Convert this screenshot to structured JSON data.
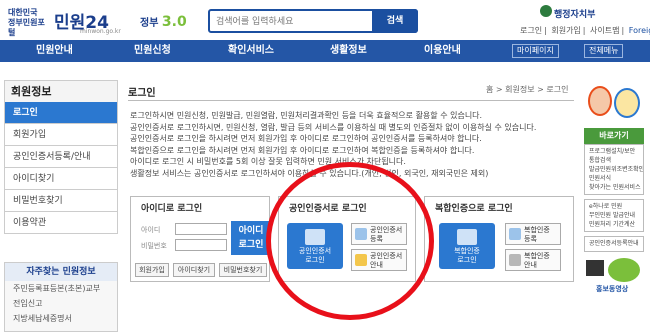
{
  "header": {
    "logo_small": "대한민국\n정부민원포털",
    "logo_main": "민원24",
    "logo_sub": "minwon.go.kr",
    "gov_label": "정부",
    "gov_version": "3.0",
    "search_placeholder": "검색어를 입력하세요",
    "search_button": "검색",
    "ministry": "행정자치부",
    "links": [
      "로그인",
      "회원가입",
      "사이트맵",
      "Foreigner"
    ]
  },
  "gnb": {
    "items": [
      "민원안내",
      "민원신청",
      "확인서비스",
      "생활정보",
      "이용안내"
    ],
    "mypage": "마이페이지",
    "allmenu": "전체메뉴"
  },
  "sidebar": {
    "title": "회원정보",
    "items": [
      "로그인",
      "회원가입",
      "공인인증서등록/안내",
      "아이디찾기",
      "비밀번호찾기",
      "이용약관"
    ],
    "faq_title": "자주찾는 민원정보",
    "faq_items": [
      "주민등록표등본(초본)교부",
      "전입신고",
      "지방세납세증명서"
    ]
  },
  "content": {
    "title": "로그인",
    "breadcrumb": "홈 > 회원정보 > 로그인",
    "notes": [
      "로그인하시면 민원신청, 민원발급, 민원열람, 민원처리결과확인 등을 더욱 효율적으로 활용할 수 있습니다.",
      "공인인증서로 로그인하시면, 민원신청, 열람, 발급 등의 서비스를 이용하실 때 별도의 인증절차 없이 이용하실 수 있습니다.",
      "공인인증서로 로그인을 하시려면 먼저 회원가입 후 아이디로 로그인하여 공인인증서를 등록하셔야 합니다.",
      "복합인증으로 로그인을 하시려면 먼저 회원가입 후 아이디로 로그인하여 복합인증을 등록하셔야 합니다.",
      "아이디로 로그인 시 비밀번호를 5회 이상 잘못 입력하면 민원 서비스가 차단됩니다.",
      "생활정보 서비스는 공인인증서로 로그인하셔야 이용하실 수 있습니다.(개인, 법인, 외국인, 재외국민은 제외)"
    ],
    "id_login": {
      "title": "아이디로 로그인",
      "id_label": "아이디",
      "pw_label": "비밀번호",
      "login_button": "아이디\n로그인",
      "buttons": [
        "회원가입",
        "아이디찾기",
        "비밀번호찾기"
      ]
    },
    "cert_login": {
      "title": "공인인증서로 로그인",
      "main_button": "공인인증서\n로그인",
      "register_button": "공인인증서\n등록",
      "guide_button": "공인인증서\n안내"
    },
    "complex_login": {
      "title": "복합인증으로 로그인",
      "main_button": "복합인증\n로그인",
      "register_button": "복합인증\n등록",
      "guide_button": "복합인증\n안내"
    }
  },
  "right_panel": {
    "title": "바로가기",
    "items": [
      "프로그램설치/보안",
      "통합검색",
      "발급민원위조변조확인",
      "민원서식",
      "찾아가는 민원서비스"
    ],
    "items2": [
      "e하나로 민원",
      "무인민원 발급안내",
      "민원처리 기간계산"
    ],
    "item3": "공인인증서등록안내",
    "promo": "홍보동영상"
  }
}
